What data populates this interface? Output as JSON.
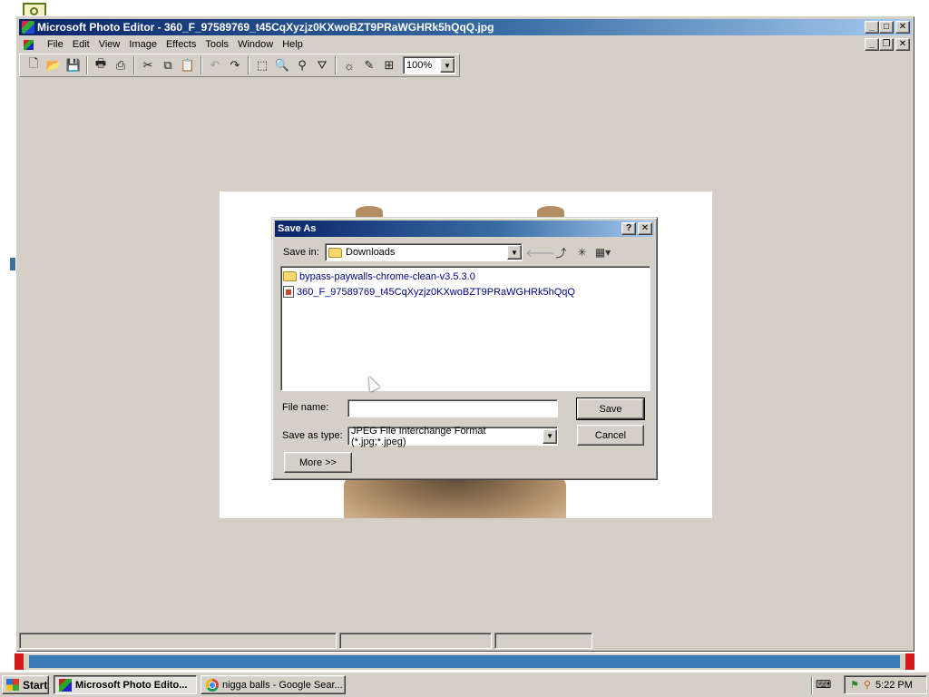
{
  "window": {
    "title": "Microsoft Photo Editor - 360_F_97589769_t45CqXyzjz0KXwoBZT9PRaWGHRk5hQqQ.jpg",
    "caption_minimize": "_",
    "caption_maximize": "□",
    "caption_close": "✕",
    "mdi_restore": "❐"
  },
  "menu": {
    "items": [
      "File",
      "Edit",
      "View",
      "Image",
      "Effects",
      "Tools",
      "Window",
      "Help"
    ]
  },
  "toolbar": {
    "zoom_value": "100%",
    "dropdown_arrow": "▼",
    "icons": [
      "new-icon",
      "open-icon",
      "save-icon",
      "print-icon",
      "scan-icon",
      "cut-icon",
      "copy-icon",
      "paste-icon",
      "undo-icon",
      "redo-icon",
      "select-icon",
      "zoom-icon",
      "pin-icon",
      "triangle-select-icon",
      "brightness-icon",
      "pen-icon",
      "image-properties-icon"
    ]
  },
  "dialog": {
    "title": "Save As",
    "help_btn": "?",
    "close_btn": "✕",
    "save_in_label": "Save in:",
    "save_in_value": "Downloads",
    "files": [
      {
        "name": "bypass-paywalls-chrome-clean-v3.5.3.0",
        "type": "folder"
      },
      {
        "name": "360_F_97589769_t45CqXyzjz0KXwoBZT9PRaWGHRk5hQqQ",
        "type": "image"
      }
    ],
    "file_name_label": "File name:",
    "file_name_value": "",
    "save_as_type_label": "Save as type:",
    "save_as_type_value": "JPEG File Interchange Format (*.jpg;*.jpeg)",
    "save_button": "Save",
    "cancel_button": "Cancel",
    "more_button": "More >>"
  },
  "taskbar": {
    "start_label": "Start",
    "tasks": [
      {
        "label": "Microsoft Photo Edito..."
      },
      {
        "label": "nigga balls - Google Sear..."
      }
    ],
    "clock": "5:22 PM"
  }
}
